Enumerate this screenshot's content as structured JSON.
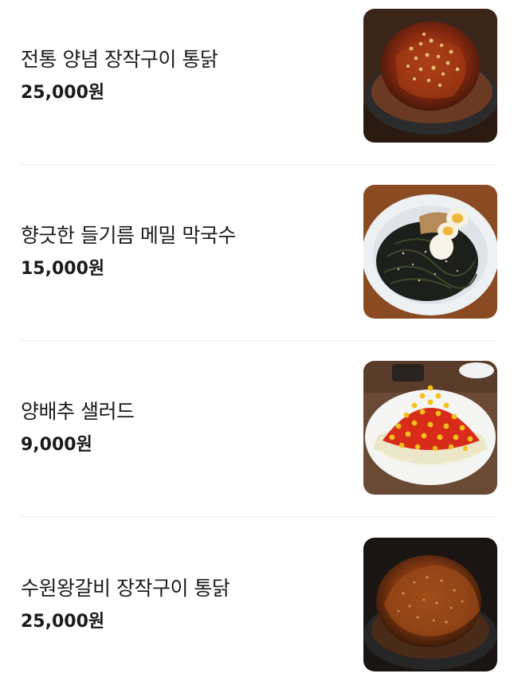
{
  "menu": {
    "items": [
      {
        "name": "전통 양념 장작구이 통닭",
        "price": "25,000원",
        "image": "spicy-whole-chicken-photo-icon"
      },
      {
        "name": "향긋한 들기름 메밀 막국수",
        "price": "15,000원",
        "image": "perilla-buckwheat-noodles-photo-icon"
      },
      {
        "name": "양배추 샐러드",
        "price": "9,000원",
        "image": "cabbage-corn-salad-photo-icon"
      },
      {
        "name": "수원왕갈비 장작구이 통닭",
        "price": "25,000원",
        "image": "galbi-whole-chicken-photo-icon"
      }
    ]
  },
  "colors": {
    "text": "#1b1b1b",
    "divider": "#ececec",
    "background": "#ffffff"
  }
}
